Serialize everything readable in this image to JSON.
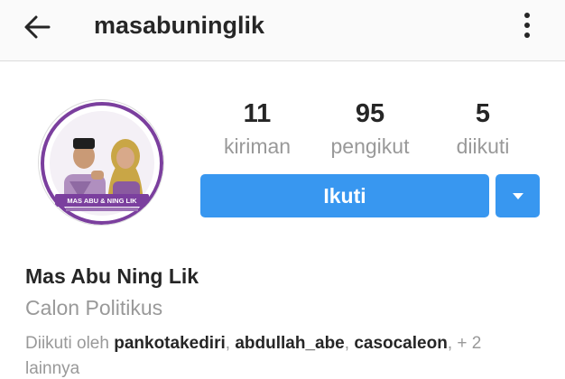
{
  "header": {
    "username": "masabuninglik",
    "back_icon": "arrow-left-icon",
    "more_icon": "more-vertical-icon"
  },
  "avatar": {
    "banner_text": "MAS ABU & NING LIK",
    "colors": {
      "ring": "#7b3f9e",
      "shirt": "#b08fbf",
      "hijab": "#c9a646"
    }
  },
  "stats": [
    {
      "value": "11",
      "label": "kiriman"
    },
    {
      "value": "95",
      "label": "pengikut"
    },
    {
      "value": "5",
      "label": "diikuti"
    }
  ],
  "actions": {
    "follow_label": "Ikuti",
    "dropdown_icon": "caret-down-icon",
    "accent_color": "#3897f0"
  },
  "profile": {
    "name": "Mas Abu Ning Lik",
    "category": "Calon Politikus",
    "followed_by_prefix": "Diikuti oleh ",
    "followers": [
      "pankotakediri",
      "abdullah_abe",
      "casocaleon"
    ],
    "sep1": ", ",
    "sep2": ", ",
    "followed_by_suffix": ", + 2 lainnya"
  }
}
